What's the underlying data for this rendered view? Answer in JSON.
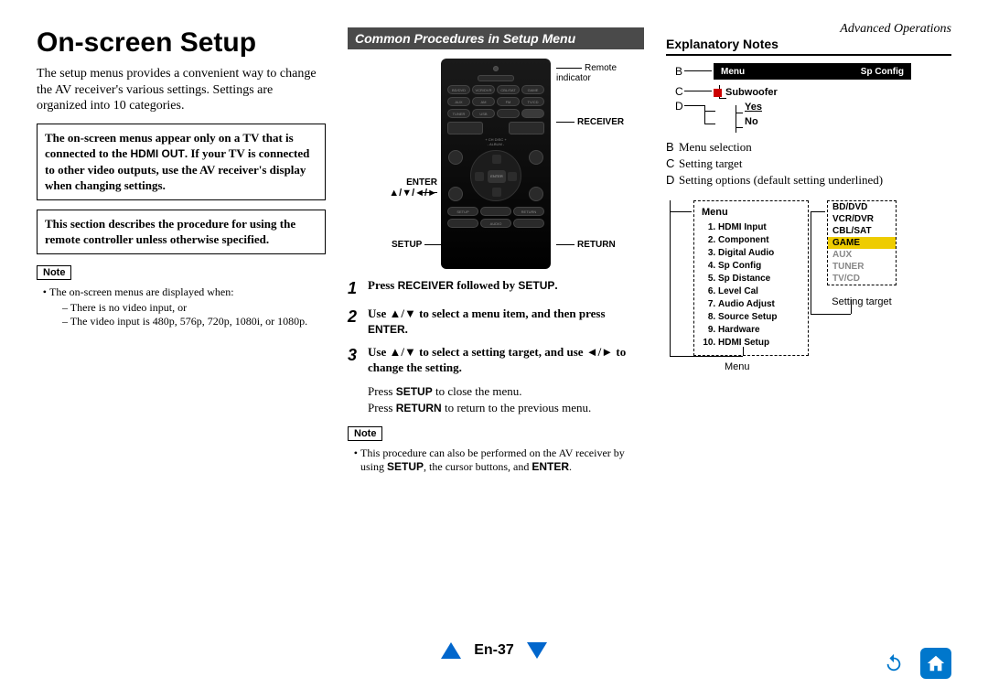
{
  "header": {
    "section": "Advanced Operations"
  },
  "col1": {
    "title": "On-screen Setup",
    "intro": "The setup menus provides a convenient way to change the AV receiver's various settings. Settings are organized into 10 categories.",
    "warn1_a": "The on-screen menus appear only on a TV that is connected to the ",
    "warn1_b": "HDMI OUT",
    "warn1_c": ". If your TV is connected to other video outputs, use the AV receiver's display when changing settings.",
    "warn2": "This section describes the procedure for using the remote controller unless otherwise specified.",
    "note_label": "Note",
    "note_intro": "The on-screen menus are displayed when:",
    "note_li1": "– There is no video input, or",
    "note_li2": "– The video input is 480p, 576p, 720p, 1080i, or 1080p."
  },
  "col2": {
    "banner": "Common Procedures in Setup Menu",
    "labels": {
      "remote_indicator": "Remote indicator",
      "receiver": "RECEIVER",
      "enter": "ENTER",
      "arrows": "▲/▼/◄/►",
      "setup": "SETUP",
      "return": "RETURN"
    },
    "step1": {
      "n": "1",
      "pre": "Press ",
      "k1": "RECEIVER",
      "mid": " followed by ",
      "k2": "SETUP",
      "post": "."
    },
    "step2": {
      "n": "2",
      "pre": "Use ",
      "k1": "▲",
      "slash1": "/",
      "k2": "▼",
      "mid": " to select a menu item, and then press ",
      "k3": "ENTER",
      "post": "."
    },
    "step3": {
      "n": "3",
      "pre": "Use ",
      "k1": "▲",
      "s1": "/",
      "k2": "▼",
      "mid1": " to select a setting target, and use ",
      "k3": "◄",
      "s2": "/",
      "k4": "►",
      "mid2": " to change the setting."
    },
    "after1a": "Press ",
    "after1k": "SETUP",
    "after1b": " to close the menu.",
    "after2a": "Press ",
    "after2k": "RETURN",
    "after2b": " to return to the previous menu.",
    "note_label": "Note",
    "proc_note_a": "This procedure can also be performed on the AV receiver by using ",
    "proc_note_k1": "SETUP",
    "proc_note_b": ", the cursor buttons, and ",
    "proc_note_k2": "ENTER",
    "proc_note_c": "."
  },
  "col3": {
    "title": "Explanatory Notes",
    "letters": {
      "B": "B",
      "C": "C",
      "D": "D"
    },
    "menubar": {
      "menu": "Menu",
      "spconfig": "Sp Config"
    },
    "tree": {
      "subwoofer": "Subwoofer",
      "yes": "Yes",
      "no": "No"
    },
    "legend": {
      "B": "Menu selection",
      "C": "Setting target",
      "D": "Setting options (default setting underlined)"
    },
    "menu_title": "Menu",
    "menu_items": [
      "HDMI Input",
      "Component",
      "Digital Audio",
      "Sp Config",
      "Sp Distance",
      "Level Cal",
      "Audio Adjust",
      "Source Setup",
      "Hardware",
      "HDMI Setup"
    ],
    "targets": [
      "BD/DVD",
      "VCR/DVR",
      "CBL/SAT",
      "GAME",
      "AUX",
      "TUNER",
      "TV/CD"
    ],
    "target_highlight_index": 3,
    "target_grey_start": 4,
    "label_menu": "Menu",
    "label_target": "Setting target"
  },
  "footer": {
    "page": "En-37"
  }
}
